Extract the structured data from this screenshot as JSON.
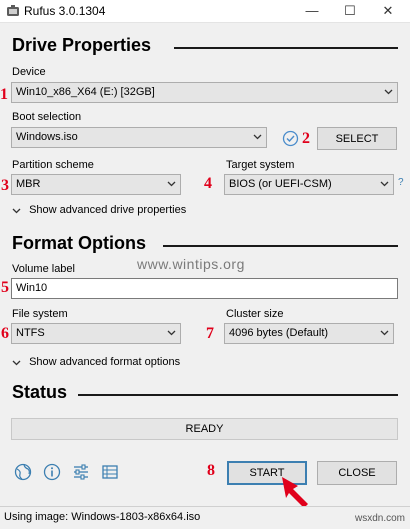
{
  "window": {
    "title": "Rufus 3.0.1304",
    "minimize": "—",
    "maximize": "☐",
    "close": "✕"
  },
  "drive_properties": {
    "title": "Drive Properties",
    "device_label": "Device",
    "device_value": "Win10_x86_X64 (E:) [32GB]",
    "boot_selection_label": "Boot selection",
    "boot_selection_value": "Windows.iso",
    "select_button": "SELECT",
    "partition_scheme_label": "Partition scheme",
    "partition_scheme_value": "MBR",
    "target_system_label": "Target system",
    "target_system_value": "BIOS (or UEFI-CSM)",
    "help_mark": "?",
    "advanced_toggle": "Show advanced drive properties"
  },
  "format_options": {
    "title": "Format Options",
    "volume_label_label": "Volume label",
    "volume_label_value": "Win10",
    "file_system_label": "File system",
    "file_system_value": "NTFS",
    "cluster_size_label": "Cluster size",
    "cluster_size_value": "4096 bytes (Default)",
    "advanced_toggle": "Show advanced format options"
  },
  "status": {
    "title": "Status",
    "state": "READY"
  },
  "actions": {
    "start_button": "START",
    "close_button": "CLOSE"
  },
  "footer": {
    "text": "Using image: Windows-1803-x86x64.iso"
  },
  "annotations": {
    "m1": "1",
    "m2": "2",
    "m3": "3",
    "m4": "4",
    "m5": "5",
    "m6": "6",
    "m7": "7",
    "m8": "8"
  },
  "watermarks": {
    "center": "www.wintips.org",
    "corner": "wsxdn.com"
  },
  "colors": {
    "marker_red": "#e0001b",
    "accent_blue": "#3c7fb1",
    "check_blue": "#4a8ccb"
  },
  "icons": [
    "rufus-app-icon",
    "globe-icon",
    "info-icon",
    "settings-sliders-icon",
    "log-table-icon",
    "checkmark-circle-icon",
    "chevron-down-icon",
    "red-arrow-icon"
  ]
}
